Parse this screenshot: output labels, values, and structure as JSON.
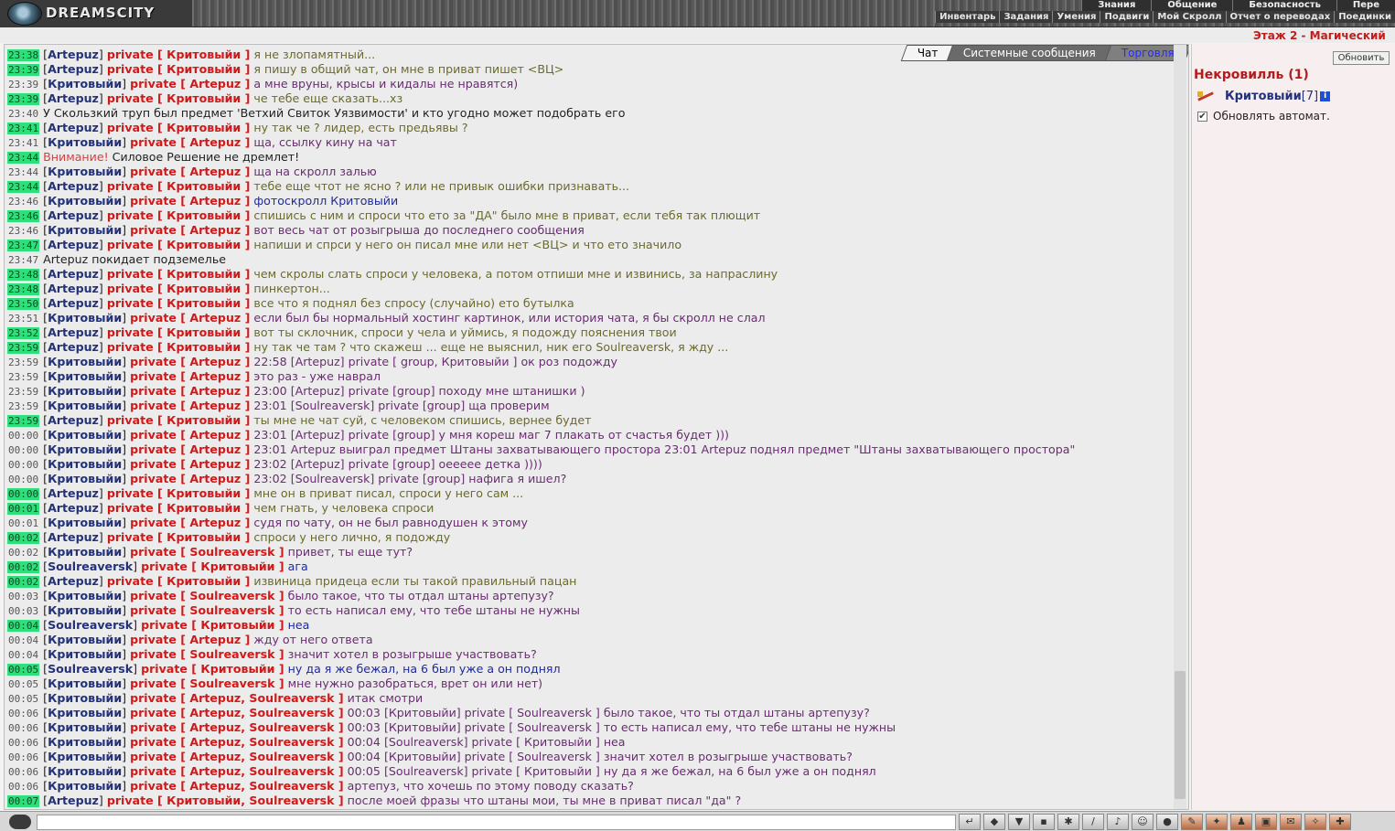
{
  "header": {
    "logo_text": "DREAMSCITY",
    "menu_top": [
      "Знания",
      "Общение",
      "Безопасность",
      "Пере"
    ],
    "menu_bottom": [
      "Инвентарь",
      "Задания",
      "Умения",
      "Подвиги",
      "Мой Скролл",
      "Отчет о переводах",
      "Поединки"
    ],
    "floor_title": "Этаж 2 - Магический"
  },
  "tabs": [
    "Чат",
    "Системные сообщения",
    "Торговля"
  ],
  "chat": [
    {
      "t": "23:38",
      "hl": true,
      "nick": "Artepuz",
      "to": "Критовыйи",
      "text": "я не злопамятный...",
      "c": "msg"
    },
    {
      "t": "23:39",
      "hl": true,
      "nick": "Artepuz",
      "to": "Критовыйи",
      "text": "я пишу в общий чат, он мне в приват пишет <ВЦ>",
      "c": "msg"
    },
    {
      "t": "23:39",
      "hl": false,
      "nick": "Критовыйи",
      "to": "Artepuz",
      "text": "а мне вруны, крысы и кидалы не нравятся)",
      "c": "mine"
    },
    {
      "t": "23:39",
      "hl": true,
      "nick": "Artepuz",
      "to": "Критовыйи",
      "text": "че тебе еще сказать...хз",
      "c": "msg"
    },
    {
      "t": "23:40",
      "hl": false,
      "sys": "У Скользкий труп был предмет 'Ветхий Свиток Уязвимости' и кто угодно может подобрать его"
    },
    {
      "t": "23:41",
      "hl": true,
      "nick": "Artepuz",
      "to": "Критовыйи",
      "text": "ну так че ? лидер, есть предьявы ?",
      "c": "msg"
    },
    {
      "t": "23:41",
      "hl": false,
      "nick": "Критовыйи",
      "to": "Artepuz",
      "text": "ща, ссылку кину на чат",
      "c": "mine"
    },
    {
      "t": "23:44",
      "hl": true,
      "warn": "Внимание!",
      "sys": "Силовое Решение не дремлет!"
    },
    {
      "t": "23:44",
      "hl": false,
      "nick": "Критовыйи",
      "to": "Artepuz",
      "text": "ща на скролл залью",
      "c": "mine"
    },
    {
      "t": "23:44",
      "hl": true,
      "nick": "Artepuz",
      "to": "Критовыйи",
      "text": "тебе еще чтот не ясно ? или не привык ошибки признавать...",
      "c": "msg"
    },
    {
      "t": "23:46",
      "hl": false,
      "nick": "Критовыйи",
      "to": "Artepuz",
      "text": "фотоскролл Критовыйи",
      "c": "blue"
    },
    {
      "t": "23:46",
      "hl": true,
      "nick": "Artepuz",
      "to": "Критовыйи",
      "text": "спишись с ним и спроси что ето за \"ДА\" было мне в приват, если тебя так плющит",
      "c": "msg"
    },
    {
      "t": "23:46",
      "hl": false,
      "nick": "Критовыйи",
      "to": "Artepuz",
      "text": "вот весь чат от розыгрыша до последнего сообщения",
      "c": "mine"
    },
    {
      "t": "23:47",
      "hl": true,
      "nick": "Artepuz",
      "to": "Критовыйи",
      "text": "напиши и спрси у него он писал мне или нет <ВЦ> и что ето значило",
      "c": "msg"
    },
    {
      "t": "23:47",
      "hl": false,
      "sys": "Artepuz покидает подземелье"
    },
    {
      "t": "23:48",
      "hl": true,
      "nick": "Artepuz",
      "to": "Критовыйи",
      "text": "чем скролы слать спроси у человека, а потом отпиши мне и извинись, за напраслину",
      "c": "msg"
    },
    {
      "t": "23:48",
      "hl": true,
      "nick": "Artepuz",
      "to": "Критовыйи",
      "text": "пинкертон...",
      "c": "msg"
    },
    {
      "t": "23:50",
      "hl": true,
      "nick": "Artepuz",
      "to": "Критовыйи",
      "text": "все что я поднял без спросу (случайно) ето бутылка",
      "c": "msg"
    },
    {
      "t": "23:51",
      "hl": false,
      "nick": "Критовыйи",
      "to": "Artepuz",
      "text": "если был бы нормальный хостинг картинок, или история чата, я бы скролл не слал",
      "c": "mine"
    },
    {
      "t": "23:52",
      "hl": true,
      "nick": "Artepuz",
      "to": "Критовыйи",
      "text": "вот ты склочник, спроси у чела и уймись, я подожду пояснения твои",
      "c": "msg"
    },
    {
      "t": "23:59",
      "hl": true,
      "nick": "Artepuz",
      "to": "Критовыйи",
      "text": "ну так че там ? что скажеш ... еще не выяснил, ник его Soulreaversk, я жду ...",
      "c": "msg"
    },
    {
      "t": "23:59",
      "hl": false,
      "nick": "Критовыйи",
      "to": "Artepuz",
      "text": "22:58 [Artepuz] private [ group, Критовыйи ] ок роз подожду",
      "c": "mine"
    },
    {
      "t": "23:59",
      "hl": false,
      "nick": "Критовыйи",
      "to": "Artepuz",
      "text": "это раз - уже наврал",
      "c": "mine"
    },
    {
      "t": "23:59",
      "hl": false,
      "nick": "Критовыйи",
      "to": "Artepuz",
      "text": "23:00 [Artepuz] private [group] походу мне штанишки )",
      "c": "mine"
    },
    {
      "t": "23:59",
      "hl": false,
      "nick": "Критовыйи",
      "to": "Artepuz",
      "text": "23:01 [Soulreaversk] private [group] ща проверим",
      "c": "mine"
    },
    {
      "t": "23:59",
      "hl": true,
      "nick": "Artepuz",
      "to": "Критовыйи",
      "text": "ты мне не чат суй, с человеком спишись, вернее будет",
      "c": "msg"
    },
    {
      "t": "00:00",
      "hl": false,
      "nick": "Критовыйи",
      "to": "Artepuz",
      "text": "23:01 [Artepuz] private [group] у мня кореш маг 7 плакать от счастья будет )))",
      "c": "mine"
    },
    {
      "t": "00:00",
      "hl": false,
      "nick": "Критовыйи",
      "to": "Artepuz",
      "text": "23:01 Artepuz выиграл предмет Штаны захватывающего простора 23:01 Artepuz поднял предмет \"Штаны захватывающего простора\"",
      "c": "mine"
    },
    {
      "t": "00:00",
      "hl": false,
      "nick": "Критовыйи",
      "to": "Artepuz",
      "text": "23:02 [Artepuz] private [group] оееееe детка ))))",
      "c": "mine"
    },
    {
      "t": "00:00",
      "hl": false,
      "nick": "Критовыйи",
      "to": "Artepuz",
      "text": "23:02 [Soulreaversk] private [group] нафига я ишел?",
      "c": "mine"
    },
    {
      "t": "00:00",
      "hl": true,
      "nick": "Artepuz",
      "to": "Критовыйи",
      "text": "мне он в приват писал, спроси у него сам ...",
      "c": "msg"
    },
    {
      "t": "00:01",
      "hl": true,
      "nick": "Artepuz",
      "to": "Критовыйи",
      "text": "чем гнать, у человека спроси",
      "c": "msg"
    },
    {
      "t": "00:01",
      "hl": false,
      "nick": "Критовыйи",
      "to": "Artepuz",
      "text": "судя по чату, он не был равнодушен к этому",
      "c": "mine"
    },
    {
      "t": "00:02",
      "hl": true,
      "nick": "Artepuz",
      "to": "Критовыйи",
      "text": "спроси у него лично, я подожду",
      "c": "msg"
    },
    {
      "t": "00:02",
      "hl": false,
      "nick": "Критовыйи",
      "to": "Soulreaversk",
      "text": "привет, ты еще тут?",
      "c": "mine"
    },
    {
      "t": "00:02",
      "hl": true,
      "nick": "Soulreaversk",
      "to": "Критовыйи",
      "text": "ага",
      "c": "blue"
    },
    {
      "t": "00:02",
      "hl": true,
      "nick": "Artepuz",
      "to": "Критовыйи",
      "text": "извиница придеца если ты такой правильный пацан",
      "c": "msg"
    },
    {
      "t": "00:03",
      "hl": false,
      "nick": "Критовыйи",
      "to": "Soulreaversk",
      "text": "было такое, что ты отдал штаны артепузу?",
      "c": "mine"
    },
    {
      "t": "00:03",
      "hl": false,
      "nick": "Критовыйи",
      "to": "Soulreaversk",
      "text": "то есть написал ему, что тебе штаны не нужны",
      "c": "mine"
    },
    {
      "t": "00:04",
      "hl": true,
      "nick": "Soulreaversk",
      "to": "Критовыйи",
      "text": "неа",
      "c": "blue"
    },
    {
      "t": "00:04",
      "hl": false,
      "nick": "Критовыйи",
      "to": "Artepuz",
      "text": "жду от него ответа",
      "c": "mine"
    },
    {
      "t": "00:04",
      "hl": false,
      "nick": "Критовыйи",
      "to": "Soulreaversk",
      "text": "значит хотел в розыгрыше участвовать?",
      "c": "mine"
    },
    {
      "t": "00:05",
      "hl": true,
      "nick": "Soulreaversk",
      "to": "Критовыйи",
      "text": "ну да я же бежал, на 6 был уже а он поднял",
      "c": "blue"
    },
    {
      "t": "00:05",
      "hl": false,
      "nick": "Критовыйи",
      "to": "Soulreaversk",
      "text": "мне нужно разобраться, врет он или нет)",
      "c": "mine"
    },
    {
      "t": "00:05",
      "hl": false,
      "nick": "Критовыйи",
      "to": "Artepuz, Soulreaversk",
      "text": "итак смотри",
      "c": "mine"
    },
    {
      "t": "00:06",
      "hl": false,
      "nick": "Критовыйи",
      "to": "Artepuz, Soulreaversk",
      "text": "00:03 [Критовыйи] private [ Soulreaversk ] было такое, что ты отдал штаны артепузу?",
      "c": "mine"
    },
    {
      "t": "00:06",
      "hl": false,
      "nick": "Критовыйи",
      "to": "Artepuz, Soulreaversk",
      "text": "00:03 [Критовыйи] private [ Soulreaversk ] то есть написал ему, что тебе штаны не нужны",
      "c": "mine"
    },
    {
      "t": "00:06",
      "hl": false,
      "nick": "Критовыйи",
      "to": "Artepuz, Soulreaversk",
      "text": "00:04 [Soulreaversk] private [ Критовыйи ] неа",
      "c": "mine"
    },
    {
      "t": "00:06",
      "hl": false,
      "nick": "Критовыйи",
      "to": "Artepuz, Soulreaversk",
      "text": "00:04 [Критовыйи] private [ Soulreaversk ] значит хотел в розыгрыше участвовать?",
      "c": "mine"
    },
    {
      "t": "00:06",
      "hl": false,
      "nick": "Критовыйи",
      "to": "Artepuz, Soulreaversk",
      "text": "00:05 [Soulreaversk] private [ Критовыйи ] ну да я же бежал, на 6 был уже а он поднял",
      "c": "mine"
    },
    {
      "t": "00:06",
      "hl": false,
      "nick": "Критовыйи",
      "to": "Artepuz, Soulreaversk",
      "text": "артепуз, что хочешь по этому поводу сказать?",
      "c": "mine"
    },
    {
      "t": "00:07",
      "hl": true,
      "nick": "Artepuz",
      "to": "Критовыйи, Soulreaversk",
      "text": "после моей фразы что штаны мои, ты мне в приват писал \"да\" ?",
      "c": "mine"
    }
  ],
  "side": {
    "refresh_label": "Обновить",
    "location": "Некровилль (1)",
    "user_name": "Критовыйи",
    "user_level": "[7]",
    "info_glyph": "i",
    "auto_label": "Обновлять автомат."
  },
  "bottom": {
    "icons": [
      "back-icon",
      "eraser-icon",
      "filter-icon",
      "save-icon",
      "figure-icon",
      "slash-icon",
      "sound-icon",
      "smiley-icon",
      "mask-icon",
      "paw-icon",
      "sword-icon",
      "figure2-icon",
      "chest-icon",
      "scroll-icon",
      "misc-icon",
      "misc2-icon"
    ],
    "icon_glyphs": [
      "↵",
      "◆",
      "▼",
      "▪",
      "✱",
      "/",
      "♪",
      "☺",
      "●",
      "✎",
      "✦",
      "♟",
      "▣",
      "✉",
      "✧",
      "✚"
    ]
  },
  "colors": {
    "time_highlight": "#2ee07a",
    "nick": "#23327a",
    "private": "#d21919",
    "msg": "#6b6b29",
    "own_msg": "#6b2b73"
  }
}
